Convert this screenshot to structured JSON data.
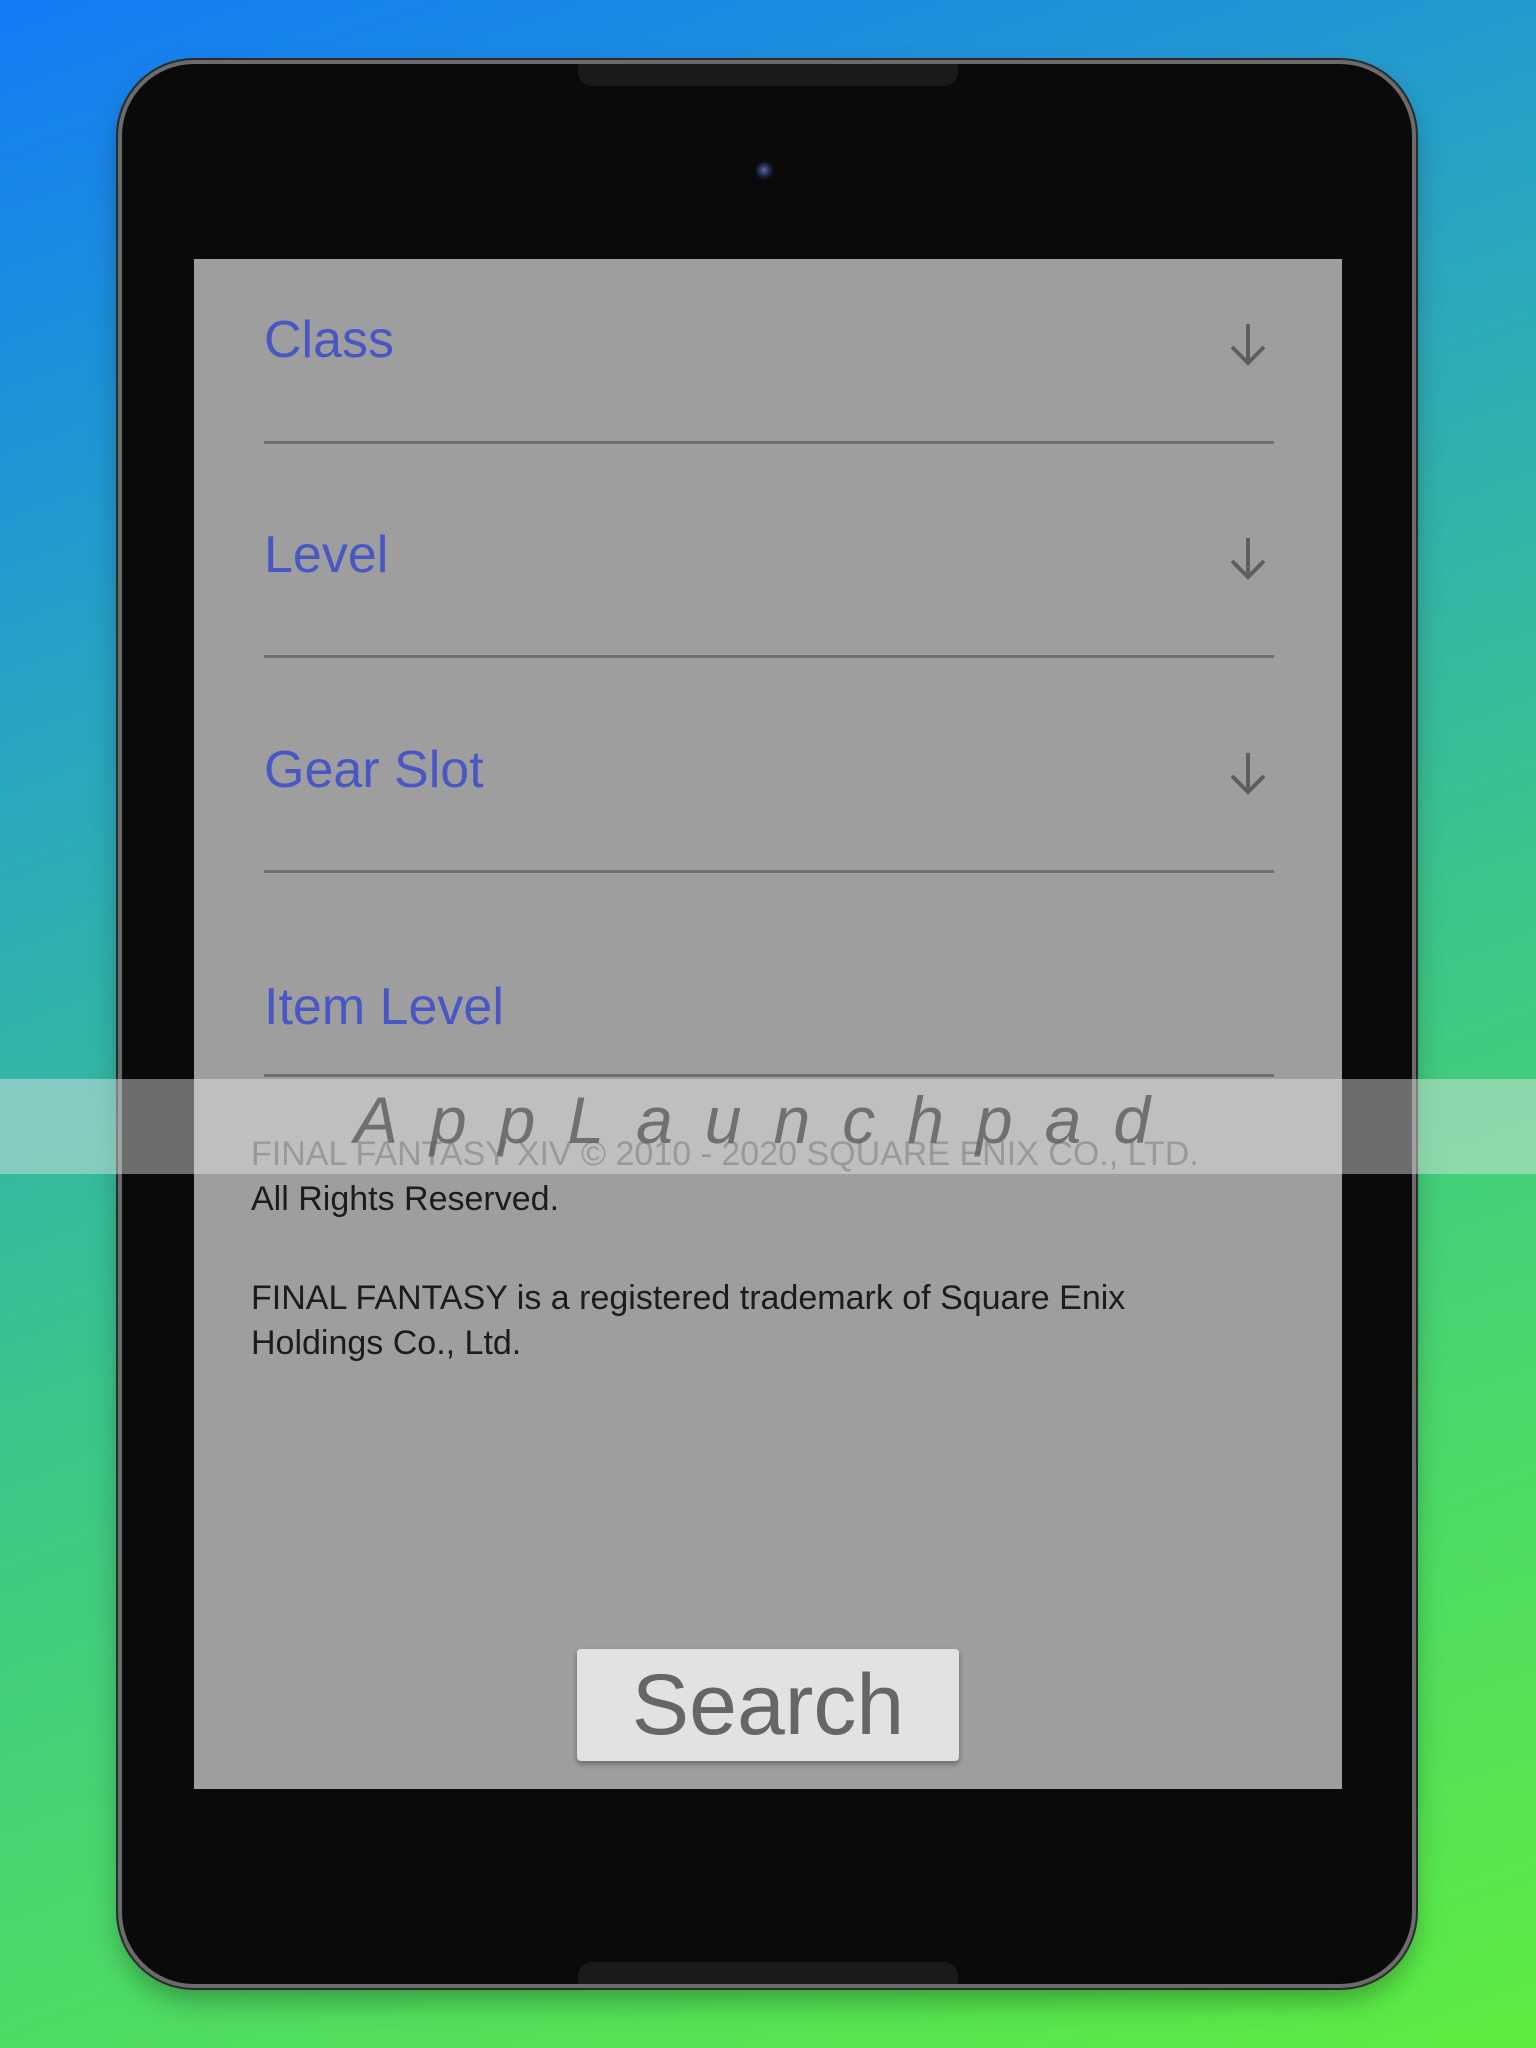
{
  "form": {
    "fields": [
      {
        "label": "Class",
        "type": "dropdown"
      },
      {
        "label": "Level",
        "type": "dropdown"
      },
      {
        "label": "Gear Slot",
        "type": "dropdown"
      },
      {
        "label": "Item Level",
        "type": "text"
      }
    ],
    "dropdown_icon": "arrow-down-icon"
  },
  "legal": {
    "copyright_line1": "FINAL FANTASY XIV © 2010 - 2020 SQUARE ENIX CO., LTD.",
    "copyright_line2": "All Rights Reserved.",
    "trademark_line1": "FINAL FANTASY is a registered trademark of Square Enix",
    "trademark_line2": "Holdings Co., Ltd."
  },
  "actions": {
    "search_label": "Search"
  },
  "watermark": {
    "text": "AppLaunchpad"
  },
  "colors": {
    "screen_bg": "#9e9e9e",
    "label_accent": "#4857c4",
    "divider": "#6f6f6f",
    "button_bg": "#e2e2e2",
    "button_text": "#666666"
  }
}
